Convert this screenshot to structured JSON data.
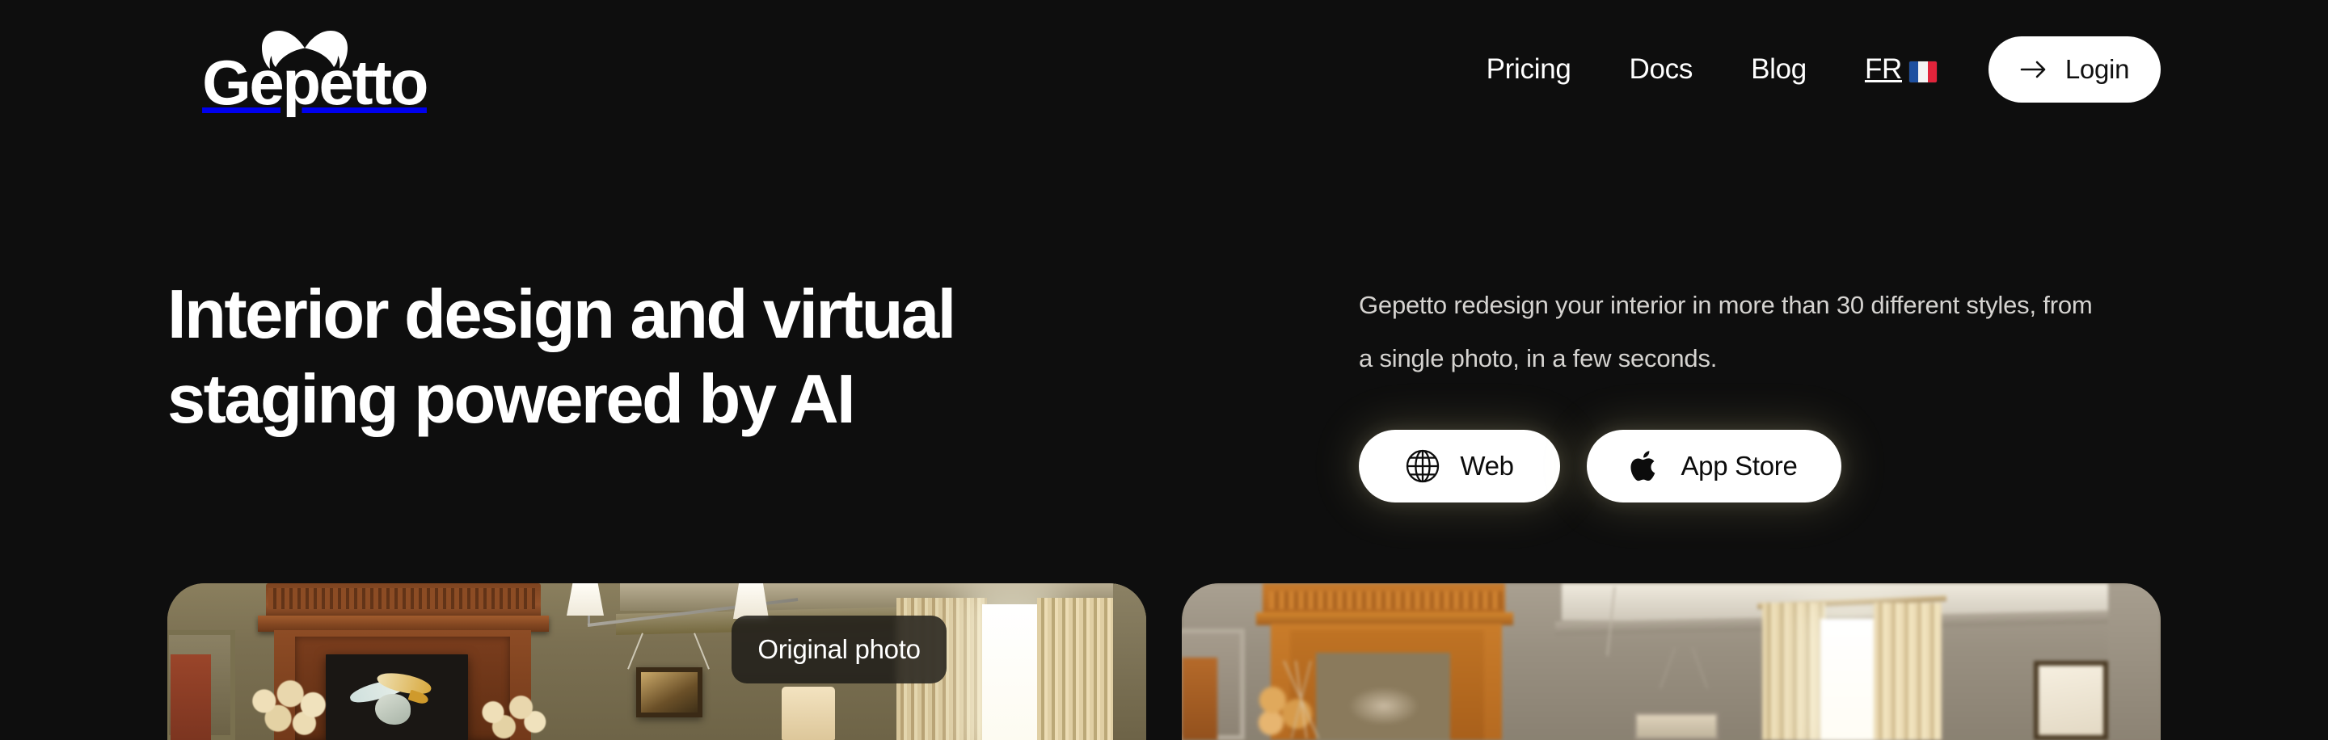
{
  "brand": {
    "name": "Gepetto",
    "mark_icon": "mustache-icon"
  },
  "nav": {
    "items": [
      {
        "label": "Pricing"
      },
      {
        "label": "Docs"
      },
      {
        "label": "Blog"
      }
    ],
    "language": {
      "code": "FR",
      "flag_icon": "flag-fr-icon"
    },
    "login": {
      "label": "Login",
      "icon": "arrow-right-icon"
    }
  },
  "hero": {
    "headline": "Interior design and virtual staging powered by AI",
    "subcopy": "Gepetto redesign your interior in more than 30 different styles, from a single photo, in a few seconds.",
    "cta": [
      {
        "label": "Web",
        "icon": "globe-icon"
      },
      {
        "label": "App Store",
        "icon": "apple-icon"
      }
    ]
  },
  "showcase": {
    "badge_label": "Original photo",
    "cards": [
      {
        "name": "original-photo-card",
        "alt": "Olive green room with wooden fireplace mantel, framed bird artwork, dried hydrangeas and pendant lamps"
      },
      {
        "name": "ai-redesign-card",
        "alt": "AI redesigned version of the same room with warm orange wood and grey walls"
      }
    ]
  },
  "colors": {
    "background": "#0e0e0e",
    "text_primary": "#ffffff",
    "text_secondary": "#d5d3d0",
    "button_bg": "#ffffff",
    "button_text": "#0c0c0c",
    "glow": "#eee296"
  }
}
